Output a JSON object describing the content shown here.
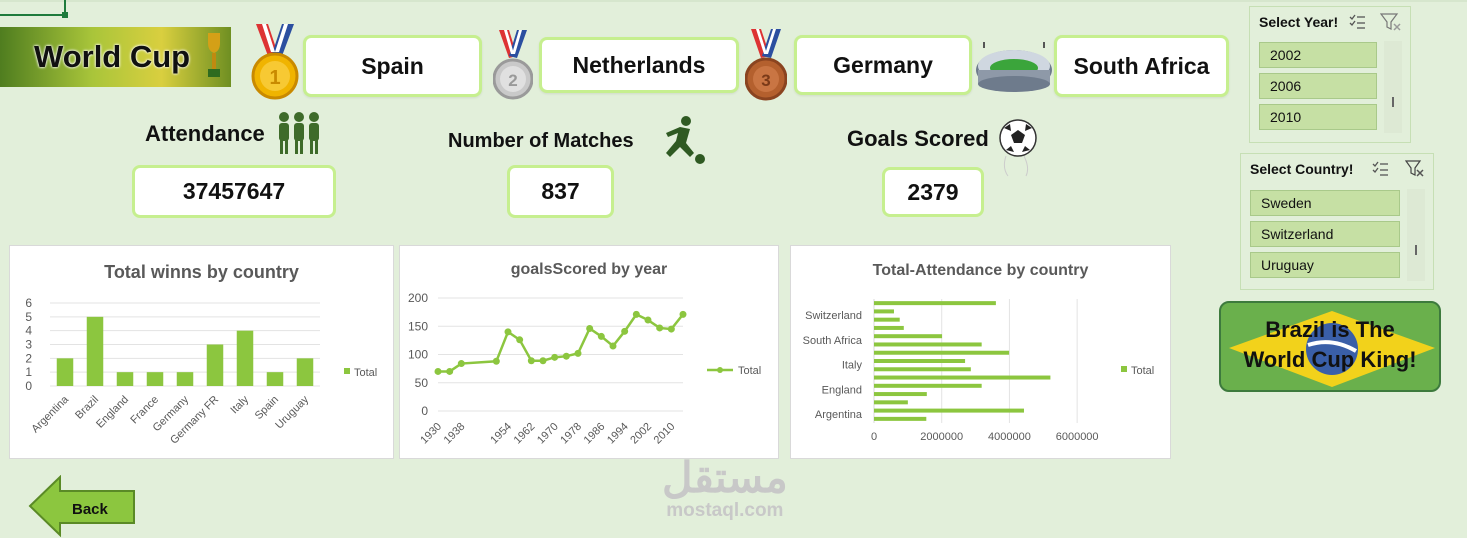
{
  "banner": {
    "title": "World Cup"
  },
  "podium": {
    "first": "Spain",
    "second": "Netherlands",
    "third": "Germany",
    "host": "South Africa"
  },
  "kpis": {
    "attendance": {
      "label": "Attendance",
      "value": "37457647"
    },
    "matches": {
      "label": "Number of Matches",
      "value": "837"
    },
    "goals": {
      "label": "Goals Scored",
      "value": "2379"
    }
  },
  "slicers": {
    "year": {
      "title": "Select Year!",
      "items": [
        "2002",
        "2006",
        "2010"
      ]
    },
    "country": {
      "title": "Select Country!",
      "items": [
        "Sweden",
        "Switzerland",
        "Uruguay"
      ]
    }
  },
  "king": {
    "line1": "Brazil is The",
    "line2": "World Cup King!"
  },
  "back": {
    "label": "Back"
  },
  "watermark": {
    "arabic": "مستقل",
    "latin": "mostaql.com"
  },
  "colors": {
    "accent": "#8cc63f",
    "pill_border": "#c6ef8f",
    "background": "#e2efda"
  },
  "chart_data": [
    {
      "type": "bar",
      "title": "Total winns by country",
      "categories": [
        "Argentina",
        "Brazil",
        "England",
        "France",
        "Germany",
        "Germany FR",
        "Italy",
        "Spain",
        "Uruguay"
      ],
      "series": [
        {
          "name": "Total",
          "values": [
            2,
            5,
            1,
            1,
            1,
            3,
            4,
            1,
            2
          ]
        }
      ],
      "ylim": [
        0,
        6
      ],
      "yticks": [
        "0",
        "1",
        "2",
        "3",
        "4",
        "5",
        "6"
      ],
      "legend": "right"
    },
    {
      "type": "line",
      "title": "goalsScored by year",
      "x": [
        1930,
        1934,
        1938,
        1950,
        1954,
        1958,
        1962,
        1966,
        1970,
        1974,
        1978,
        1982,
        1986,
        1990,
        1994,
        1998,
        2002,
        2006,
        2010,
        2014
      ],
      "series": [
        {
          "name": "Total",
          "values": [
            70,
            70,
            84,
            88,
            140,
            126,
            89,
            89,
            95,
            97,
            102,
            146,
            132,
            115,
            141,
            171,
            161,
            147,
            145,
            171
          ]
        }
      ],
      "xticks": [
        "1930",
        "1938",
        "1954",
        "1962",
        "1970",
        "1978",
        "1986",
        "1994",
        "2002",
        "2010"
      ],
      "ylim": [
        0,
        200
      ],
      "yticks": [
        "0",
        "50",
        "100",
        "150",
        "200"
      ],
      "legend": "right"
    },
    {
      "type": "bar",
      "orientation": "horizontal",
      "title": "Total-Attendance by country",
      "categories": [
        "Argentina",
        "",
        "England",
        "",
        "Italy",
        "",
        "South Africa",
        "",
        "Switzerland",
        ""
      ],
      "series": [
        {
          "name": "Total",
          "values": [
            1545000,
            4430000,
            1000000,
            1560000,
            3180000,
            5210000,
            2860000,
            2690000,
            3990000,
            3180000,
            2010000,
            880000,
            760000,
            590000,
            3600000
          ]
        }
      ],
      "ylabels": [
        "Argentina",
        "England",
        "Italy",
        "South Africa",
        "Switzerland"
      ],
      "xlim": [
        0,
        7000000
      ],
      "xticks": [
        "0",
        "2000000",
        "4000000",
        "6000000"
      ],
      "legend": "right"
    }
  ]
}
